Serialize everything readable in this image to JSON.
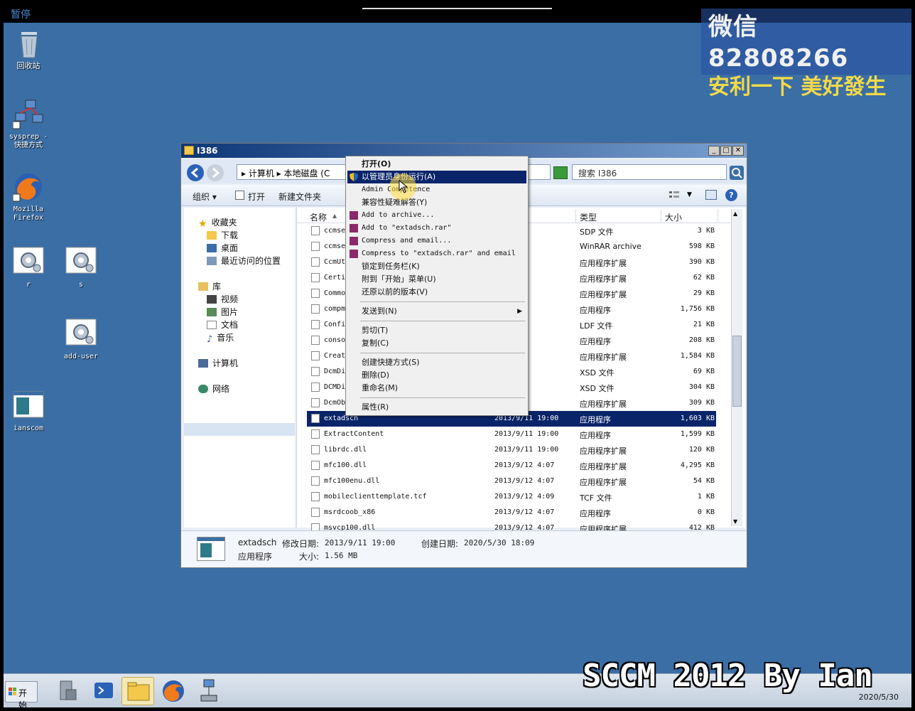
{
  "top_bar": {
    "pause_label": "暂停"
  },
  "watermark": {
    "line1": "微信 82808266",
    "line2": "安利一下 美好發生"
  },
  "desktop_icons": [
    {
      "label": "回收站"
    },
    {
      "label": "sysprep -\n快捷方式"
    },
    {
      "label": "Mozilla\nFirefox"
    },
    {
      "label": "r"
    },
    {
      "label": "s"
    },
    {
      "label": "add-user"
    },
    {
      "label": "ianscom"
    }
  ],
  "window": {
    "title": "I386",
    "address": "▸ 计算机 ▸ 本地磁盘 (C",
    "search_placeholder": "搜索 I386",
    "toolbar": {
      "organize": "组织 ▾",
      "open": "打开",
      "new_folder": "新建文件夹"
    }
  },
  "nav": {
    "favorites": "收藏夹",
    "downloads": "下载",
    "desktop": "桌面",
    "recent": "最近访问的位置",
    "libraries": "库",
    "videos": "视频",
    "pictures": "图片",
    "documents": "文档",
    "music": "音乐",
    "computer": "计算机",
    "network": "网络"
  },
  "columns": {
    "name": "名称",
    "type": "类型",
    "size": "大小"
  },
  "files": [
    {
      "name": "ccmse",
      "date": "2 4:09",
      "type": "SDP 文件",
      "size": "3 KB"
    },
    {
      "name": "ccmse",
      "date": "1 19:00",
      "type": "WinRAR archive",
      "size": "598 KB"
    },
    {
      "name": "CcmUt",
      "date": "1 19:00",
      "type": "应用程序扩展",
      "size": "390 KB"
    },
    {
      "name": "Certi",
      "date": "1 19:00",
      "type": "应用程序扩展",
      "size": "62 KB"
    },
    {
      "name": "Commo",
      "date": "1 19:00",
      "type": "应用程序扩展",
      "size": "29 KB"
    },
    {
      "name": "compm",
      "date": "1 19:00",
      "type": "应用程序",
      "size": "1,756 KB"
    },
    {
      "name": "Confi",
      "date": "2 4:09",
      "type": "LDF 文件",
      "size": "21 KB"
    },
    {
      "name": "conso",
      "date": "1 19:00",
      "type": "应用程序",
      "size": "208 KB"
    },
    {
      "name": "Creat",
      "date": "1 19:00",
      "type": "应用程序扩展",
      "size": "1,584 KB"
    },
    {
      "name": "DcmDi",
      "date": "2 4:03",
      "type": "XSD 文件",
      "size": "69 KB"
    },
    {
      "name": "DCMDi",
      "date": "2 4:07",
      "type": "XSD 文件",
      "size": "304 KB"
    },
    {
      "name": "DcmOb",
      "date": "1 19:00",
      "type": "应用程序扩展",
      "size": "309 KB"
    },
    {
      "name": "extadsch",
      "date": "2013/9/11 19:00",
      "type": "应用程序",
      "size": "1,603 KB"
    },
    {
      "name": "ExtractContent",
      "date": "2013/9/11 19:00",
      "type": "应用程序",
      "size": "1,599 KB"
    },
    {
      "name": "librdc.dll",
      "date": "2013/9/11 19:00",
      "type": "应用程序扩展",
      "size": "120 KB"
    },
    {
      "name": "mfc100.dll",
      "date": "2013/9/12 4:07",
      "type": "应用程序扩展",
      "size": "4,295 KB"
    },
    {
      "name": "mfc100enu.dll",
      "date": "2013/9/12 4:07",
      "type": "应用程序扩展",
      "size": "54 KB"
    },
    {
      "name": "mobileclienttemplate.tcf",
      "date": "2013/9/12 4:09",
      "type": "TCF 文件",
      "size": "1 KB"
    },
    {
      "name": "msrdcoob_x86",
      "date": "2013/9/12 4:07",
      "type": "应用程序",
      "size": "0 KB"
    },
    {
      "name": "msvcp100.dll",
      "date": "2013/9/12 4:07",
      "type": "应用程序扩展",
      "size": "412 KB"
    }
  ],
  "details": {
    "name": "extadsch",
    "modified_label": "修改日期:",
    "modified": "2013/9/11 19:00",
    "created_label": "创建日期:",
    "created": "2020/5/30 18:09",
    "type": "应用程序",
    "size_label": "大小:",
    "size": "1.56 MB"
  },
  "context_menu": {
    "open": "打开(O)",
    "run_as_admin": "以管理员身份运行(A)",
    "admin_competence": "Admin Competence",
    "troubleshoot": "兼容性疑难解答(Y)",
    "add_archive": "Add to archive...",
    "add_rar": "Add to \"extadsch.rar\"",
    "compress_email": "Compress and email...",
    "compress_rar_email": "Compress to \"extadsch.rar\" and email",
    "pin_taskbar": "锁定到任务栏(K)",
    "pin_start": "附到「开始」菜单(U)",
    "restore": "还原以前的版本(V)",
    "send_to": "发送到(N)",
    "cut": "剪切(T)",
    "copy": "复制(C)",
    "create_shortcut": "创建快捷方式(S)",
    "delete": "删除(D)",
    "rename": "重命名(M)",
    "properties": "属性(R)"
  },
  "taskbar": {
    "start": "开始",
    "date": "2020/5/30"
  },
  "overlay_text": "SCCM 2012 By Ian",
  "colors": {
    "desktop": "#3a6ea5",
    "selection": "#0a246a"
  }
}
